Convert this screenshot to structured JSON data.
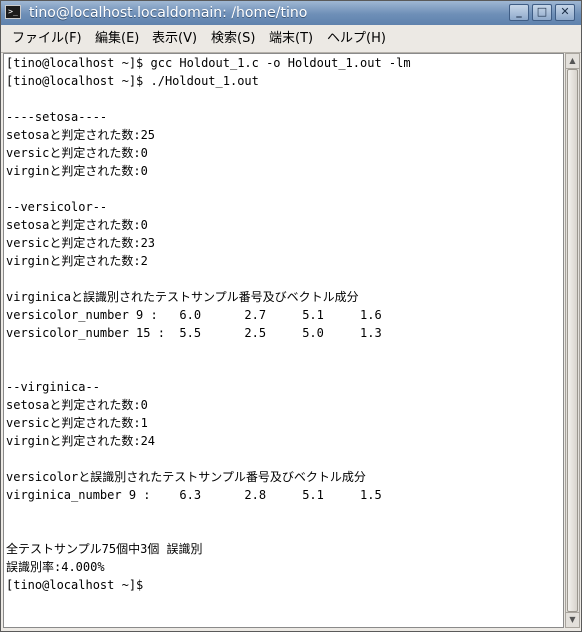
{
  "window": {
    "title": "tino@localhost.localdomain: /home/tino",
    "controls": {
      "minimize": "_",
      "maximize": "□",
      "close": "✕"
    }
  },
  "menu": [
    "ファイル(F)",
    "編集(E)",
    "表示(V)",
    "検索(S)",
    "端末(T)",
    "ヘルプ(H)"
  ],
  "terminal": {
    "lines": [
      "[tino@localhost ~]$ gcc Holdout_1.c -o Holdout_1.out -lm",
      "[tino@localhost ~]$ ./Holdout_1.out",
      "",
      "----setosa----",
      "setosaと判定された数:25",
      "versicと判定された数:0",
      "virginと判定された数:0",
      "",
      "--versicolor--",
      "setosaと判定された数:0",
      "versicと判定された数:23",
      "virginと判定された数:2",
      "",
      "virginicaと誤識別されたテストサンプル番号及びベクトル成分",
      "versicolor_number 9 :   6.0      2.7     5.1     1.6",
      "versicolor_number 15 :  5.5      2.5     5.0     1.3",
      "",
      "",
      "--virginica--",
      "setosaと判定された数:0",
      "versicと判定された数:1",
      "virginと判定された数:24",
      "",
      "versicolorと誤識別されたテストサンプル番号及びベクトル成分",
      "virginica_number 9 :    6.3      2.8     5.1     1.5",
      "",
      "",
      "全テストサンプル75個中3個 誤識別",
      "誤識別率:4.000%",
      "[tino@localhost ~]$"
    ]
  },
  "colors": {
    "titlebar": "#6e8fb7",
    "terminal_bg": "#ffffff",
    "terminal_fg": "#000000"
  }
}
